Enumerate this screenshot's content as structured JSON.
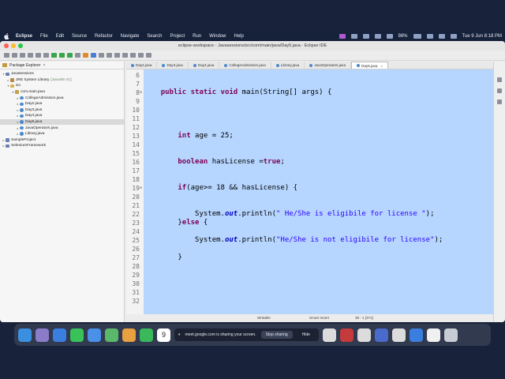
{
  "menubar": {
    "app_name": "Eclipse",
    "items": [
      "File",
      "Edit",
      "Source",
      "Refactor",
      "Navigate",
      "Search",
      "Project",
      "Run",
      "Window",
      "Help"
    ],
    "battery": "98%",
    "datetime": "Tue 9 Jun  8:18 PM"
  },
  "window": {
    "title": "eclipse-workspace - Javasessions/src/com/main/java/Day5.java - Eclipse IDE"
  },
  "sidebar": {
    "title": "Package Explorer",
    "items": [
      {
        "label": "Javasessions",
        "extra": "",
        "depth": 0,
        "arrow": "▾",
        "icon": "proj"
      },
      {
        "label": "JRE System Library",
        "extra": "[JavaSE-21]",
        "depth": 1,
        "arrow": "▸",
        "icon": "lib"
      },
      {
        "label": "src",
        "extra": "",
        "depth": 1,
        "arrow": "▾",
        "icon": "folder"
      },
      {
        "label": "com.main.java",
        "extra": "",
        "depth": 2,
        "arrow": "▾",
        "icon": "pkg"
      },
      {
        "label": "CollegeAdmission.java",
        "extra": "",
        "depth": 3,
        "arrow": "▸",
        "icon": "java"
      },
      {
        "label": "Day2.java",
        "extra": "",
        "depth": 3,
        "arrow": "▸",
        "icon": "java"
      },
      {
        "label": "Day3.java",
        "extra": "",
        "depth": 3,
        "arrow": "▸",
        "icon": "java"
      },
      {
        "label": "Day4.java",
        "extra": "",
        "depth": 3,
        "arrow": "▸",
        "icon": "java"
      },
      {
        "label": "Day5.java",
        "extra": "",
        "depth": 3,
        "arrow": "▸",
        "icon": "java",
        "selected": true
      },
      {
        "label": "JavaOperators.java",
        "extra": "",
        "depth": 3,
        "arrow": "▸",
        "icon": "java"
      },
      {
        "label": "Library.java",
        "extra": "",
        "depth": 3,
        "arrow": "▸",
        "icon": "java"
      },
      {
        "label": "SampleProject",
        "extra": "",
        "depth": 0,
        "arrow": "▸",
        "icon": "proj"
      },
      {
        "label": "SeleniumFramework",
        "extra": "",
        "depth": 0,
        "arrow": "▸",
        "icon": "proj"
      }
    ]
  },
  "tabs": [
    "Day2.java",
    "Day3.java",
    "Day4.java",
    "CollegeAdmission.java",
    "Library.java",
    "JavaOperators.java",
    "Day5.java"
  ],
  "active_tab": "Day5.java",
  "code_lines": [
    {
      "n": "6",
      "fold": "",
      "segs": []
    },
    {
      "n": "7",
      "fold": "",
      "segs": []
    },
    {
      "n": "8",
      "fold": "⊖",
      "segs": [
        [
          "",
          "    "
        ],
        [
          "kw",
          "public static void"
        ],
        [
          "",
          " main(String[] args) {"
        ]
      ]
    },
    {
      "n": "9",
      "fold": "",
      "segs": []
    },
    {
      "n": "10",
      "fold": "",
      "segs": []
    },
    {
      "n": "11",
      "fold": "",
      "segs": []
    },
    {
      "n": "12",
      "fold": "",
      "segs": []
    },
    {
      "n": "13",
      "fold": "",
      "segs": [
        [
          "",
          "        "
        ],
        [
          "kw",
          "int"
        ],
        [
          "",
          " age = 25;"
        ]
      ]
    },
    {
      "n": "14",
      "fold": "",
      "segs": []
    },
    {
      "n": "15",
      "fold": "",
      "segs": []
    },
    {
      "n": "16",
      "fold": "",
      "segs": [
        [
          "",
          "        "
        ],
        [
          "kw",
          "boolean"
        ],
        [
          "",
          " hasLicense ="
        ],
        [
          "kw",
          "true"
        ],
        [
          "",
          ";"
        ]
      ]
    },
    {
      "n": "17",
      "fold": "",
      "segs": []
    },
    {
      "n": "18",
      "fold": "",
      "segs": []
    },
    {
      "n": "19",
      "fold": "⊖",
      "segs": [
        [
          "",
          "        "
        ],
        [
          "kw",
          "if"
        ],
        [
          "",
          "(age>= 18 && hasLicense) {"
        ]
      ]
    },
    {
      "n": "20",
      "fold": "",
      "segs": []
    },
    {
      "n": "21",
      "fold": "",
      "segs": []
    },
    {
      "n": "22",
      "fold": "",
      "segs": [
        [
          "",
          "            System."
        ],
        [
          "fld",
          "out"
        ],
        [
          "",
          ".println("
        ],
        [
          "str",
          "\" He/She is eligibile for license \""
        ],
        [
          "",
          ");"
        ]
      ]
    },
    {
      "n": "23",
      "fold": "",
      "segs": [
        [
          "",
          "        }"
        ],
        [
          "kw",
          "else"
        ],
        [
          "",
          " {"
        ]
      ]
    },
    {
      "n": "24",
      "fold": "",
      "segs": []
    },
    {
      "n": "25",
      "fold": "",
      "segs": [
        [
          "",
          "            System."
        ],
        [
          "fld",
          "out"
        ],
        [
          "",
          ".println("
        ],
        [
          "str",
          "\"He/She is not eligibile for license\""
        ],
        [
          "",
          ");"
        ]
      ]
    },
    {
      "n": "26",
      "fold": "",
      "segs": []
    },
    {
      "n": "27",
      "fold": "",
      "segs": [
        [
          "",
          "        }"
        ]
      ]
    },
    {
      "n": "28",
      "fold": "",
      "segs": []
    },
    {
      "n": "29",
      "fold": "",
      "segs": []
    },
    {
      "n": "30",
      "fold": "",
      "segs": []
    },
    {
      "n": "31",
      "fold": "",
      "segs": []
    },
    {
      "n": "32",
      "fold": "",
      "segs": []
    }
  ],
  "status": {
    "mode": "Writable",
    "insert": "Smart Insert",
    "position": "38 : 1 [371]"
  },
  "screen_share": {
    "message": "meet.google.com is sharing your screen.",
    "stop_label": "Stop sharing",
    "hide_label": "Hide"
  },
  "dock": {
    "calendar_day": "9",
    "left_icons": [
      {
        "name": "finder-icon",
        "color": "#3a8fe0"
      },
      {
        "name": "launchpad-icon",
        "color": "#8a7cc8"
      },
      {
        "name": "safari-icon",
        "color": "#3a7fe0"
      },
      {
        "name": "messages-icon",
        "color": "#3ac25a"
      },
      {
        "name": "mail-icon",
        "color": "#4a8fe8"
      },
      {
        "name": "maps-icon",
        "color": "#5ab86a"
      },
      {
        "name": "photos-icon",
        "color": "#e8a040"
      },
      {
        "name": "facetime-icon",
        "color": "#3ab85a"
      }
    ],
    "right_icons": [
      {
        "name": "chrome-icon",
        "color": "#dcdcdc"
      },
      {
        "name": "app-icon",
        "color": "#c53a3a"
      },
      {
        "name": "chrome-icon",
        "color": "#dcdcdc"
      },
      {
        "name": "app-icon",
        "color": "#4a6acc"
      },
      {
        "name": "chrome-icon",
        "color": "#dcdcdc"
      },
      {
        "name": "safari-icon",
        "color": "#3a7fe0"
      },
      {
        "name": "document-icon",
        "color": "#f0f0f0"
      },
      {
        "name": "trash-icon",
        "color": "#c8ccd4"
      }
    ]
  }
}
